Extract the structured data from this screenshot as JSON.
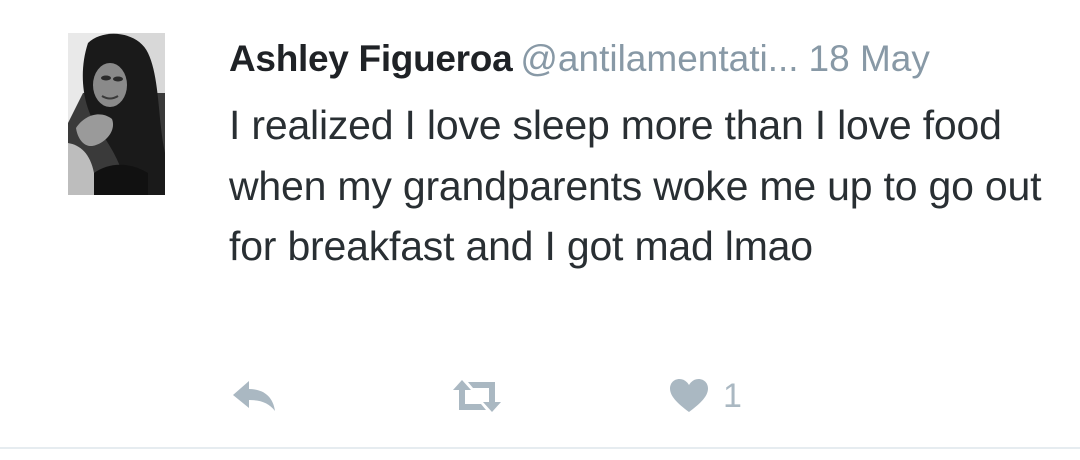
{
  "tweet": {
    "author_name": "Ashley Figueroa",
    "handle": "@antilamentati...",
    "date": "18 May",
    "text": "I realized I love sleep more than I love food when my grandparents woke me up to go out for breakfast and I got mad lmao",
    "actions": {
      "reply_icon": "reply-icon",
      "retweet_icon": "retweet-icon",
      "like_icon": "heart-icon",
      "like_count": "1"
    }
  },
  "colors": {
    "name": "#1f2226",
    "secondary_text": "#8899a6",
    "body_text": "#292f33",
    "action_icon": "#aab8c2",
    "divider": "#e6ecf0"
  }
}
